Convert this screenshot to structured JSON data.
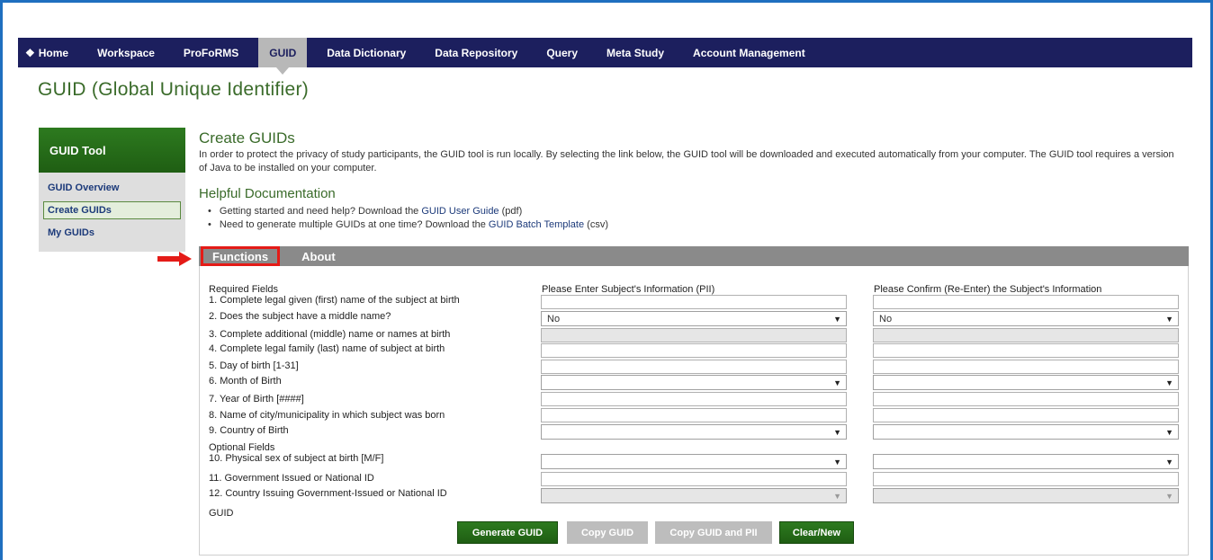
{
  "nav": {
    "items": [
      "Home",
      "Workspace",
      "ProFoRMS",
      "GUID",
      "Data Dictionary",
      "Data Repository",
      "Query",
      "Meta Study",
      "Account Management"
    ],
    "active": "GUID",
    "home_icon": "home-icon"
  },
  "page_title": "GUID (Global Unique Identifier)",
  "sidebar": {
    "title": "GUID Tool",
    "links": [
      "GUID Overview",
      "Create GUIDs",
      "My GUIDs"
    ],
    "active": "Create GUIDs"
  },
  "content": {
    "heading": "Create GUIDs",
    "intro": "In order to protect the privacy of study participants, the GUID tool is run locally. By selecting the link below, the GUID tool will be downloaded and executed automatically from your computer. The GUID tool requires a version of Java to be installed on your computer.",
    "help_heading": "Helpful Documentation",
    "doc1_prefix": "Getting started and need help? Download the ",
    "doc1_link": "GUID User Guide",
    "doc1_suffix": " (pdf)",
    "doc2_prefix": "Need to generate multiple GUIDs at one time? Download the ",
    "doc2_link": "GUID Batch Template",
    "doc2_suffix": " (csv)"
  },
  "tabs": [
    "Functions",
    "About"
  ],
  "form": {
    "required_label": "Required Fields",
    "optional_label": "Optional Fields",
    "col1_header": "Please Enter Subject's Information (PII)",
    "col2_header": "Please Confirm (Re-Enter) the Subject's Information",
    "fields": [
      "1.  Complete legal given (first) name of the subject at birth",
      "2.  Does the subject have a middle name?",
      "3.  Complete additional (middle) name or names at birth",
      "4.  Complete legal family (last) name of subject at birth",
      "5.  Day of birth [1-31]",
      "6.  Month of Birth",
      "7.  Year of Birth [####]",
      "8.  Name of city/municipality in which subject was born",
      "9.  Country of Birth",
      "10. Physical sex of subject at birth [M/F]",
      "11. Government Issued or National ID",
      "12. Country Issuing Government-Issued or National ID"
    ],
    "middle_name_value": "No",
    "guid_label": "GUID"
  },
  "buttons": {
    "generate": "Generate GUID",
    "copy": "Copy GUID",
    "copy_pii": "Copy GUID and PII",
    "clear": "Clear/New"
  },
  "colors": {
    "nav_bg": "#1c1f5e",
    "title_green": "#3a6b2a",
    "button_green": "#1f5e13",
    "highlight_red": "#e41b17",
    "frame_blue": "#1f6fbf"
  }
}
